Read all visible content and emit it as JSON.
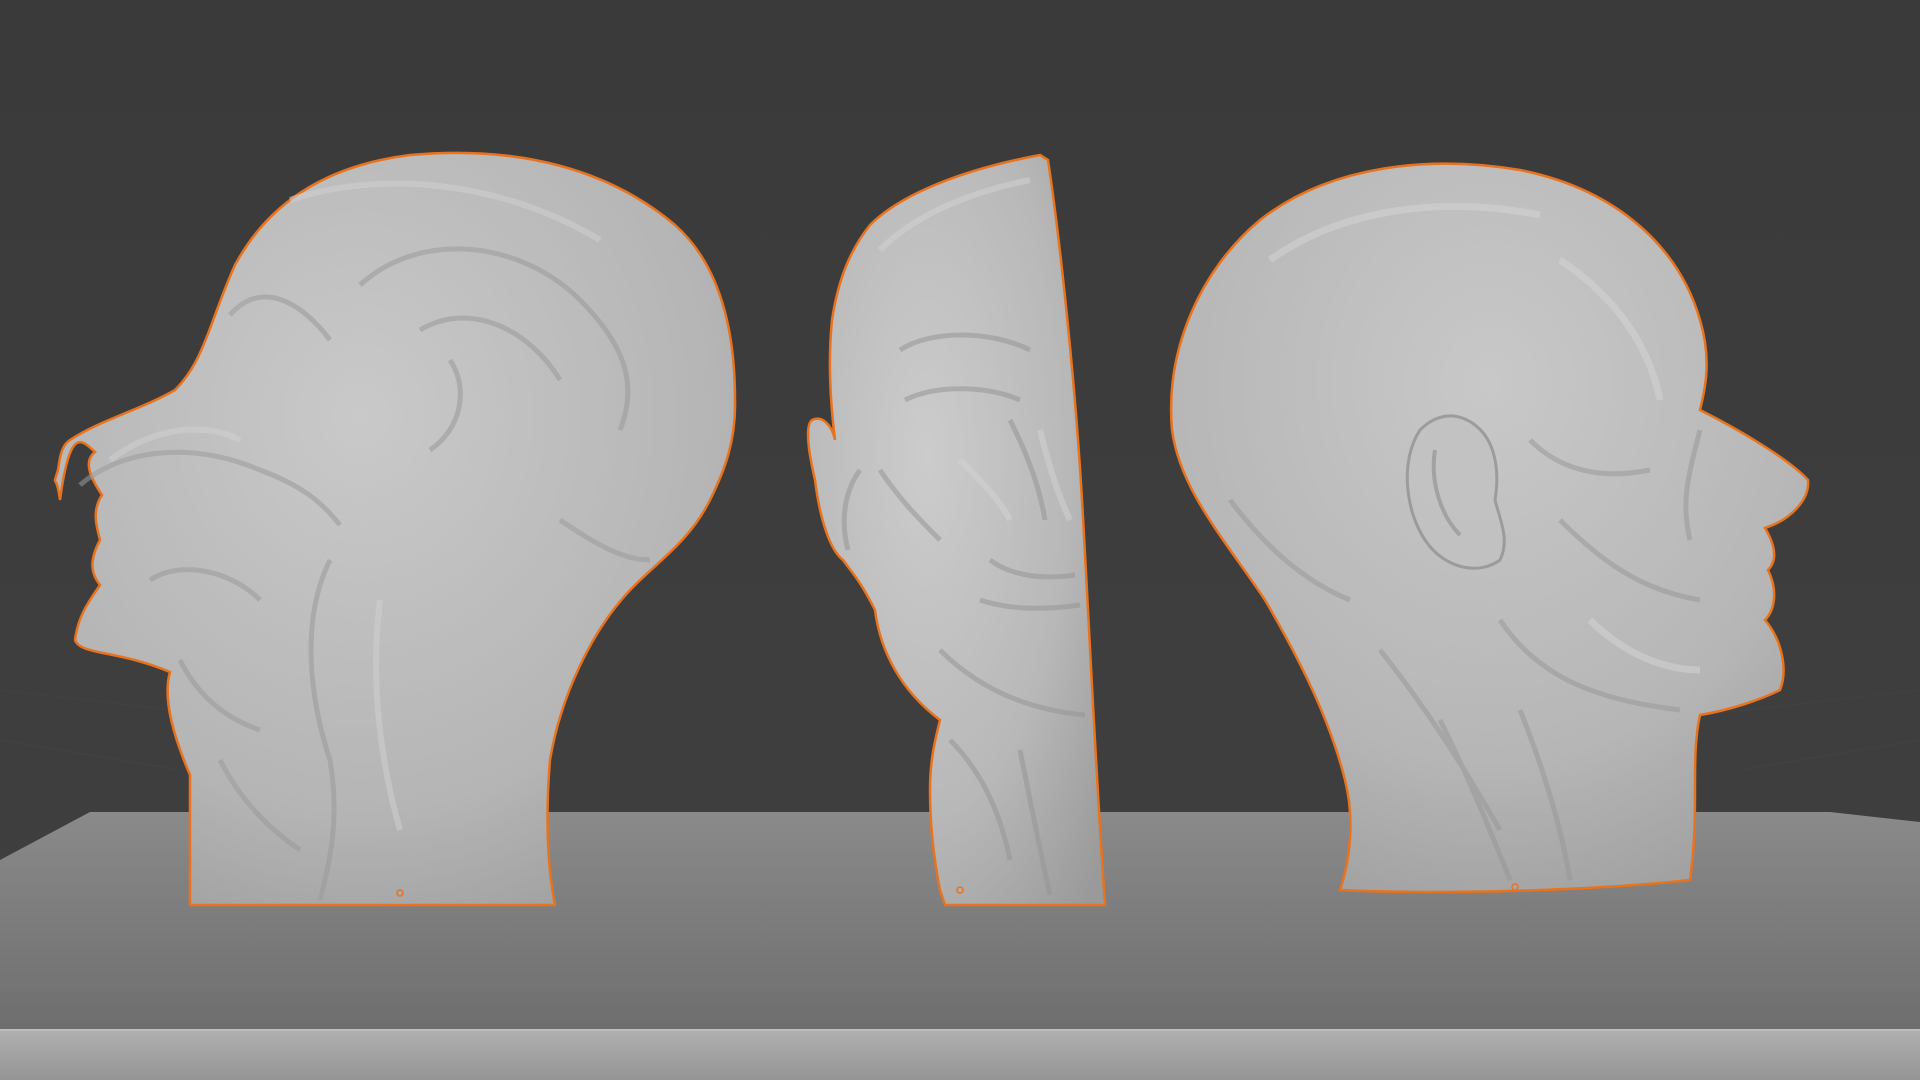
{
  "viewport": {
    "background_color": "#3d3d3d",
    "floor_top_color": "#7b7b7b",
    "floor_front_color": "#a3a3a3",
    "mesh_color": "#bdbdbd",
    "selection_outline_color": "#e8731e"
  },
  "objects": [
    {
      "name": "head-sagittal-section",
      "selected": true
    },
    {
      "name": "head-front-half-section",
      "selected": true
    },
    {
      "name": "head-full-side",
      "selected": true
    }
  ]
}
